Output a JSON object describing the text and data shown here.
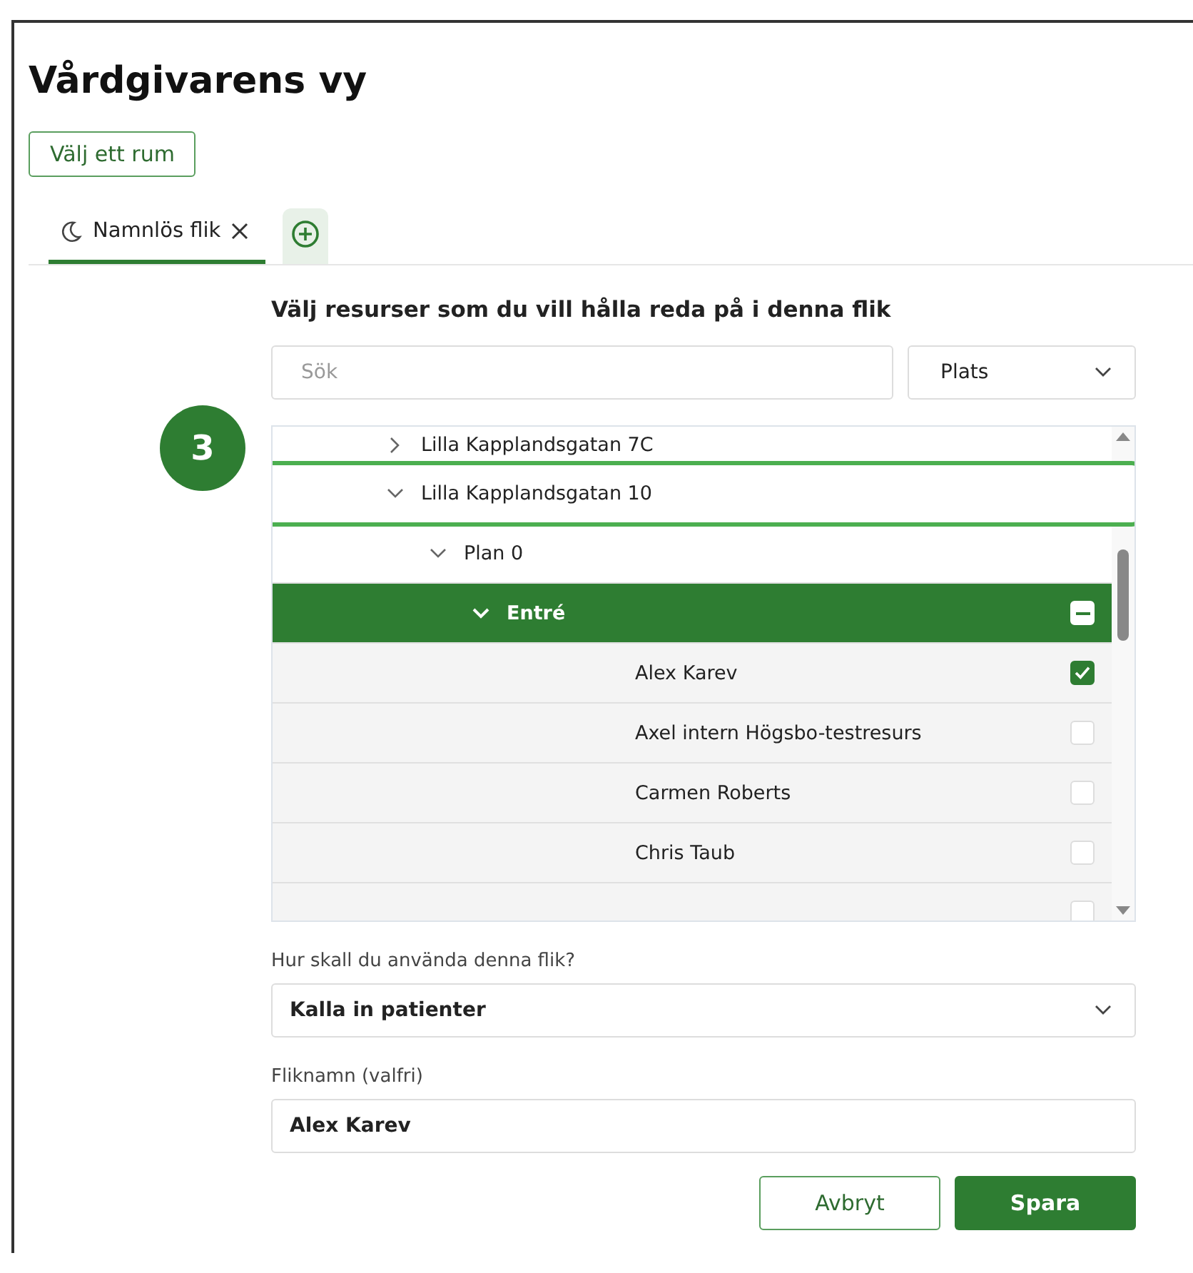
{
  "page": {
    "title": "Vårdgivarens vy",
    "room_button": "Välj ett rum"
  },
  "tabs": [
    {
      "label": "Namnlös flik",
      "selected": true
    }
  ],
  "panel": {
    "heading": "Välj resurser som du vill hålla reda på i denna flik",
    "search": {
      "placeholder": "Sök"
    },
    "filter": {
      "value": "Plats"
    },
    "callout": {
      "label": "3"
    },
    "tree": [
      {
        "label": "Lilla Kapplandsgatan 7C",
        "expanded": false,
        "highlighted": false,
        "selected": false
      },
      {
        "label": "Lilla Kapplandsgatan 10",
        "expanded": true,
        "highlighted": true,
        "selected": false,
        "children": [
          {
            "label": "Plan 0",
            "expanded": true,
            "highlighted": false,
            "selected": false,
            "children": [
              {
                "label": "Entré",
                "expanded": true,
                "highlighted": false,
                "selected": true,
                "indeterminate": true,
                "children": [
                  {
                    "label": "Alex Karev",
                    "checked": true
                  },
                  {
                    "label": "Axel intern Högsbo-testresurs",
                    "checked": false
                  },
                  {
                    "label": "Carmen Roberts",
                    "checked": false
                  },
                  {
                    "label": "Chris Taub",
                    "checked": false
                  },
                  {
                    "checked": false
                  }
                ]
              }
            ]
          }
        ]
      }
    ]
  },
  "usage": {
    "label": "Hur skall du använda denna flik?",
    "value": "Kalla in patienter"
  },
  "tab_name": {
    "label": "Fliknamn (valfri)",
    "value": "Alex Karev"
  },
  "buttons": [
    {
      "label": "Avbryt",
      "kind": "secondary"
    },
    {
      "label": "Spara",
      "kind": "primary"
    }
  ]
}
